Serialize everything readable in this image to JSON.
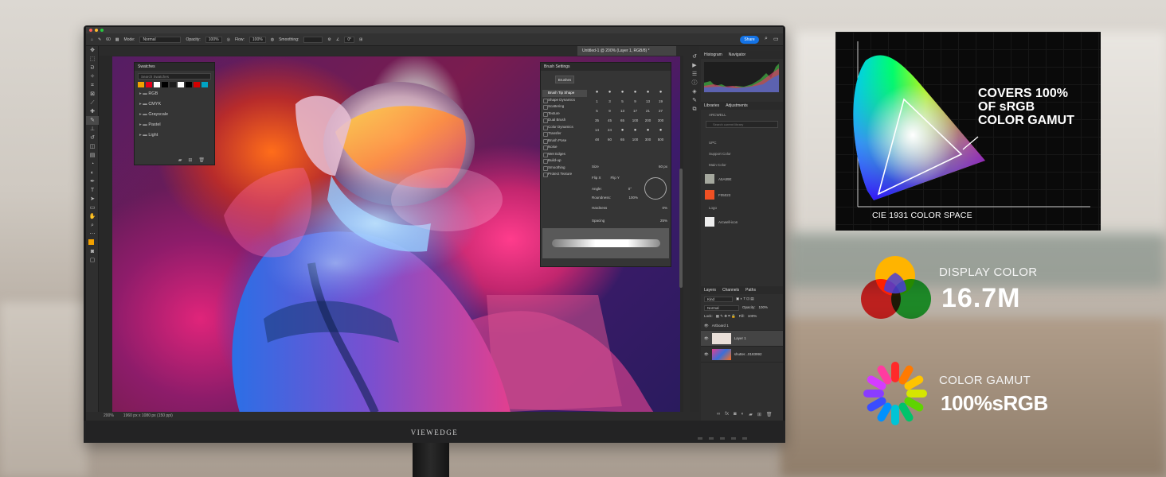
{
  "monitor": {
    "brand": "VIEWEDGE"
  },
  "photoshop": {
    "options_bar": {
      "brush_size": "60",
      "mode_label": "Mode:",
      "mode_value": "Normal",
      "opacity_label": "Opacity:",
      "opacity_value": "100%",
      "flow_label": "Flow:",
      "flow_value": "100%",
      "smoothing_label": "Smoothing:",
      "angle_value": "0°",
      "share_label": "Share"
    },
    "document_tab": "Untitled-1 @ 200% (Layer 1, RGB/8) *",
    "status_bar": {
      "zoom": "200%",
      "doc_info": "1960 px x 1080 px (150 ppi)"
    },
    "swatches": {
      "title": "Swatches",
      "search_placeholder": "Search Swatches",
      "swatch_colors": [
        "#f2a100",
        "#e3001b",
        "#ffffff",
        "#000000",
        "#1c1c1c",
        "#ffffff",
        "#000000",
        "#d40000",
        "#00a3c4"
      ],
      "groups": [
        "RGB",
        "CMYK",
        "Grayscale",
        "Pastel",
        "Light"
      ]
    },
    "brush_settings": {
      "title": "Brush Settings",
      "brushes_button": "Brushes",
      "options": [
        "Brush Tip Shape",
        "Shape Dynamics",
        "Scattering",
        "Texture",
        "Dual Brush",
        "Color Dynamics",
        "Transfer",
        "Brush Pose",
        "Noise",
        "Wet Edges",
        "Build-up",
        "Smoothing",
        "Protect Texture"
      ],
      "tip_sizes": [
        "",
        "",
        "",
        "",
        "",
        "",
        "1",
        "3",
        "5",
        "9",
        "13",
        "19",
        "5",
        "9",
        "13",
        "17",
        "21",
        "27",
        "35",
        "45",
        "65",
        "100",
        "200",
        "300",
        "14",
        "24",
        "",
        "",
        "",
        "",
        "48",
        "60",
        "65",
        "100",
        "300",
        "500"
      ],
      "size_label": "Size",
      "size_value": "60 px",
      "flip_x": "Flip X",
      "flip_y": "Flip Y",
      "angle_label": "Angle:",
      "angle_value": "0°",
      "roundness_label": "Roundness:",
      "roundness_value": "100%",
      "hardness_label": "Hardness",
      "hardness_value": "0%",
      "spacing_label": "Spacing",
      "spacing_value": "25%"
    },
    "histogram_tabs": [
      "Histogram",
      "Navigator"
    ],
    "libraries": {
      "tabs": [
        "Libraries",
        "Adjustments"
      ],
      "library_name": "ARCWELL",
      "search_placeholder": "Search current library",
      "section_upc": "UPC",
      "support_color": "Support Color",
      "main_color": "Main Color",
      "colors": [
        {
          "hex": "#A5A89E",
          "label": "A5A89E"
        },
        {
          "hex": "#F05023",
          "label": "F05023"
        }
      ],
      "logo_label": "Logo",
      "logo_name": "Arcwell-icon"
    },
    "layers": {
      "tabs": [
        "Layers",
        "Channels",
        "Paths"
      ],
      "filter_label": "Kind",
      "blend_mode": "Normal",
      "opacity_label": "Opacity:",
      "opacity_value": "100%",
      "lock_label": "Lock:",
      "fill_label": "Fill:",
      "fill_value": "100%",
      "items": [
        {
          "name": "Artboard 1"
        },
        {
          "name": "Layer 1"
        },
        {
          "name": "shutter...0183992"
        }
      ]
    }
  },
  "promo": {
    "gamut_headline": [
      "COVERS 100%",
      "OF sRGB",
      "COLOR GAMUT"
    ],
    "gamut_caption": "CIE 1931 COLOR SPACE",
    "display_color_label": "DISPLAY COLOR",
    "display_color_value": "16.7M",
    "color_gamut_label": "COLOR GAMUT",
    "color_gamut_value": "100%sRGB"
  }
}
